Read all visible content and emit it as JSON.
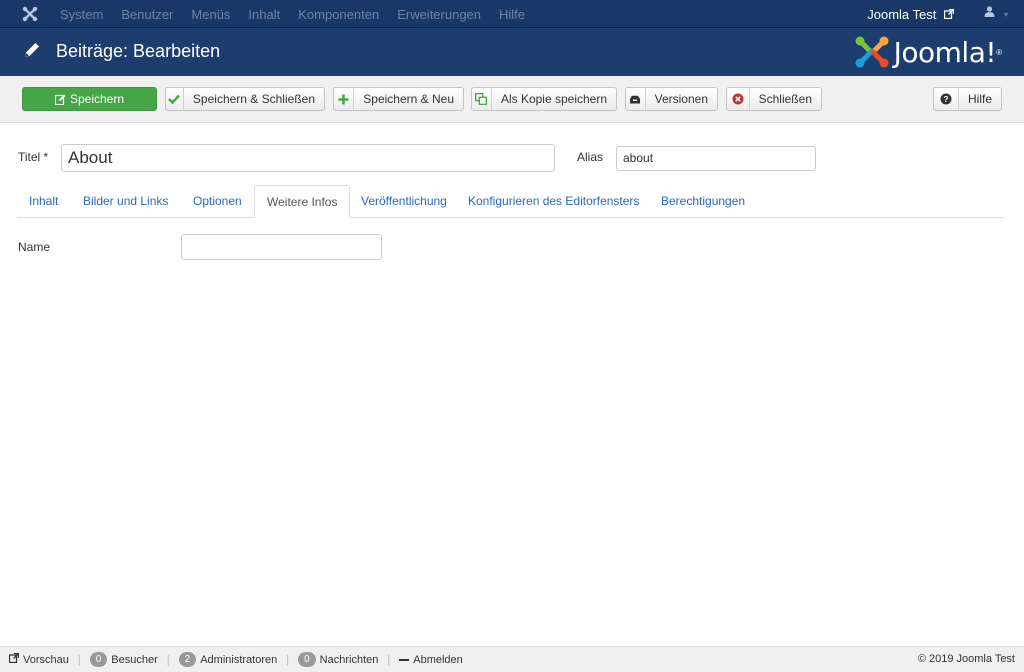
{
  "topnav": {
    "menu": [
      "System",
      "Benutzer",
      "Menüs",
      "Inhalt",
      "Komponenten",
      "Erweiterungen",
      "Hilfe"
    ],
    "site_name": "Joomla Test",
    "icons": {
      "brand": "joomla-brand-icon",
      "external": "external-link-icon",
      "user": "user-icon",
      "caret": "caret-down-icon"
    }
  },
  "header": {
    "title": "Beiträge: Bearbeiten",
    "logo_text": "Joomla!",
    "logo_mark": "®"
  },
  "toolbar": {
    "save": "Speichern",
    "save_close": "Speichern & Schließen",
    "save_new": "Speichern & Neu",
    "save_copy": "Als Kopie speichern",
    "versions": "Versionen",
    "close": "Schließen",
    "help": "Hilfe"
  },
  "form": {
    "title_label": "Titel *",
    "title_value": "About",
    "alias_label": "Alias",
    "alias_value": "about",
    "name_label": "Name",
    "name_value": ""
  },
  "tabs": [
    {
      "label": "Inhalt",
      "active": false
    },
    {
      "label": "Bilder und Links",
      "active": false
    },
    {
      "label": "Optionen",
      "active": false
    },
    {
      "label": "Weitere Infos",
      "active": true
    },
    {
      "label": "Veröffentlichung",
      "active": false
    },
    {
      "label": "Konfigurieren des Editorfensters",
      "active": false
    },
    {
      "label": "Berechtigungen",
      "active": false
    }
  ],
  "statusbar": {
    "preview": "Vorschau",
    "visitors_count": "0",
    "visitors_label": "Besucher",
    "admins_count": "2",
    "admins_label": "Administratoren",
    "messages_count": "0",
    "messages_label": "Nachrichten",
    "logout": "Abmelden",
    "copyright": "© 2019 Joomla Test"
  },
  "colors": {
    "nav_bg": "#1a3867",
    "header_bg": "#1c3d6e",
    "primary_green": "#46a546",
    "link_blue": "#2a69b8",
    "joomla_red": "#e44d26",
    "joomla_orange": "#f9a541",
    "joomla_green": "#7ac143",
    "joomla_blue": "#1c9edb"
  }
}
